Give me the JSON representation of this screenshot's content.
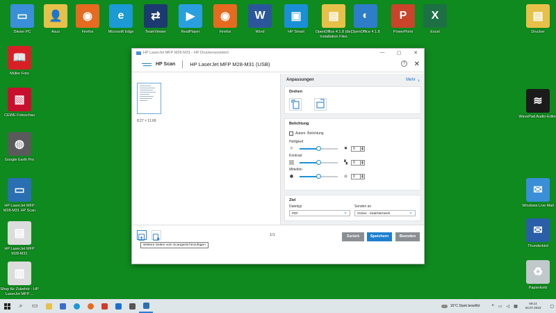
{
  "desktop": {
    "icons_top": [
      {
        "label": "Dieser PC",
        "color": "#3a8fd8",
        "icon": "computer-icon",
        "glyph": "▭"
      },
      {
        "label": "Asus",
        "color": "#e7c04a",
        "icon": "folder-icon",
        "glyph": "👤"
      },
      {
        "label": "Firefox",
        "color": "#e66a1f",
        "icon": "firefox-icon",
        "glyph": "◉"
      },
      {
        "label": "Microsoft Edge",
        "color": "#1b9ad6",
        "icon": "edge-icon",
        "glyph": "e"
      },
      {
        "label": "TeamViewer",
        "color": "#1c3a6f",
        "icon": "teamviewer-icon",
        "glyph": "⇄"
      },
      {
        "label": "RealPlayer",
        "color": "#2a9fe0",
        "icon": "realplayer-icon",
        "glyph": "▶"
      },
      {
        "label": "Firefox",
        "color": "#e66a1f",
        "icon": "firefox-icon",
        "glyph": "◉"
      },
      {
        "label": "Word",
        "color": "#2b579a",
        "icon": "word-icon",
        "glyph": "W"
      },
      {
        "label": "HP Smart",
        "color": "#1a8fd6",
        "icon": "hp-smart-icon",
        "glyph": "▣"
      },
      {
        "label": "OpenOffice 4.1.8 (de) Installation Files",
        "color": "#e7c04a",
        "icon": "folder-icon",
        "glyph": "▤"
      },
      {
        "label": "OpenOffice 4.1.8",
        "color": "#2e7dc8",
        "icon": "openoffice-icon",
        "glyph": "◐"
      },
      {
        "label": "PowerPoint",
        "color": "#c9442b",
        "icon": "powerpoint-icon",
        "glyph": "P"
      },
      {
        "label": "Excel",
        "color": "#1d7044",
        "icon": "excel-icon",
        "glyph": "X"
      }
    ],
    "icons_left": [
      {
        "label": "Müller Foto",
        "color": "#d91f26",
        "icon": "mueller-foto-icon",
        "glyph": "📖"
      },
      {
        "label": "CEWE Fotoschau",
        "color": "#c8102e",
        "icon": "cewe-icon",
        "glyph": "▧"
      },
      {
        "label": "Google Earth Pro",
        "color": "#5a5a5a",
        "icon": "google-earth-icon",
        "glyph": "◍"
      },
      {
        "label": "HP LaserJet MFP M28-M31 HP Scan",
        "color": "#2a6fb2",
        "icon": "scanner-icon",
        "glyph": "▭"
      },
      {
        "label": "HP LaserJet MFP M28-M31",
        "color": "#dcdcdc",
        "icon": "printer-icon",
        "glyph": "▤"
      },
      {
        "label": "Shop für Zubehör - HP LaserJet MFP ...",
        "color": "#dcdcdc",
        "icon": "shop-icon",
        "glyph": "▥"
      }
    ],
    "icons_right": [
      {
        "label": "Drucker",
        "color": "#e7c04a",
        "icon": "folder-icon",
        "glyph": "▤"
      },
      {
        "label": "WavePad Audio-Editor",
        "color": "#1b1b1b",
        "icon": "wavepad-icon",
        "glyph": "≋"
      },
      {
        "label": "Windows Live Mail",
        "color": "#3a8fd8",
        "icon": "mail-icon",
        "glyph": "✉"
      },
      {
        "label": "Thunderbird",
        "color": "#2a5ea8",
        "icon": "thunderbird-icon",
        "glyph": "✉"
      },
      {
        "label": "Papierkorb",
        "color": "#c0c8cc",
        "icon": "recycle-bin-icon",
        "glyph": "♻"
      }
    ]
  },
  "window": {
    "title": "HP LaserJet MFP M28-M31 - HP Druckerassistent",
    "app_name": "HP Scan",
    "device_name": "HP LaserJet MFP M28-M31 (USB)",
    "help": "?",
    "close": "✕"
  },
  "preview": {
    "dimensions": "8.27 × 11.69"
  },
  "panel": {
    "title": "Anpassungen",
    "more_label": "Mehr",
    "rotate_title": "Drehen",
    "exposure_title": "Belichtung",
    "auto_exposure_label": "Autom. Belichtung",
    "brightness_label": "Helligkeit",
    "contrast_label": "Kontrast",
    "midtones_label": "Mitteltön",
    "sliders": {
      "brightness": {
        "value": "0",
        "fraction": 0.5
      },
      "contrast": {
        "value": "0",
        "fraction": 0.5
      },
      "midtones": {
        "value": "0",
        "fraction": 0.5
      }
    },
    "dest_title": "Ziel",
    "filetype_label": "Dateityp",
    "filetype_value": "PDF",
    "sendto_label": "Senden an",
    "sendto_value": "Ordner - lokal/Netzwerk"
  },
  "footer": {
    "page_indicator": "1/1",
    "back_label": "Zurück",
    "save_label": "Speichern",
    "finish_label": "Beenden",
    "tooltip": "Weitere Seiten vom Scangerät hinzufügen"
  },
  "taskbar": {
    "weather": "16°C  Stark bewölkt",
    "time": "09:14",
    "date": "04.07.2023"
  }
}
